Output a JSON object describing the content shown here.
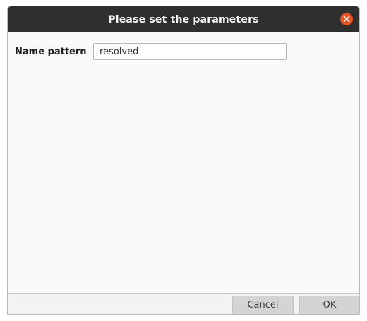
{
  "dialog": {
    "title": "Please set the parameters",
    "close_icon": "close-icon",
    "accent_color": "#e95420"
  },
  "form": {
    "name_pattern_label": "Name pattern",
    "name_pattern_value": "resolved"
  },
  "footer": {
    "cancel_label": "Cancel",
    "ok_label": "OK"
  }
}
